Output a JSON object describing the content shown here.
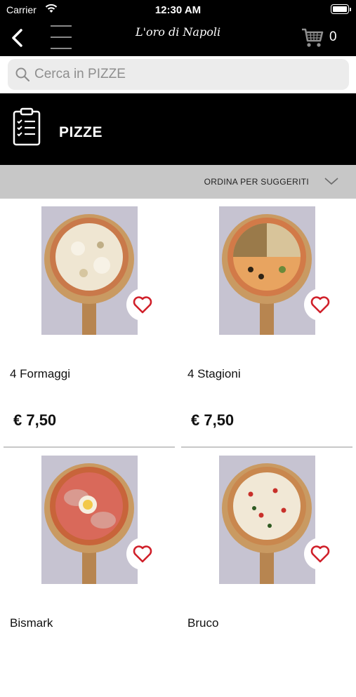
{
  "status": {
    "carrier": "Carrier",
    "time": "12:30 AM"
  },
  "nav": {
    "logo": "L'oro di Napoli",
    "cart_count": "0"
  },
  "search": {
    "placeholder": "Cerca in PIZZE"
  },
  "category": {
    "title": "PIZZE"
  },
  "sort": {
    "label": "ORDINA PER SUGGERITI"
  },
  "products": [
    {
      "name": "4 Formaggi",
      "price": "€ 7,50"
    },
    {
      "name": "4 Stagioni",
      "price": "€ 7,50"
    },
    {
      "name": "Bismark",
      "price": ""
    },
    {
      "name": "Bruco",
      "price": ""
    }
  ],
  "colors": {
    "favorite": "#d0202a",
    "header_bg": "#000000",
    "sort_bg": "#c7c7c7"
  }
}
